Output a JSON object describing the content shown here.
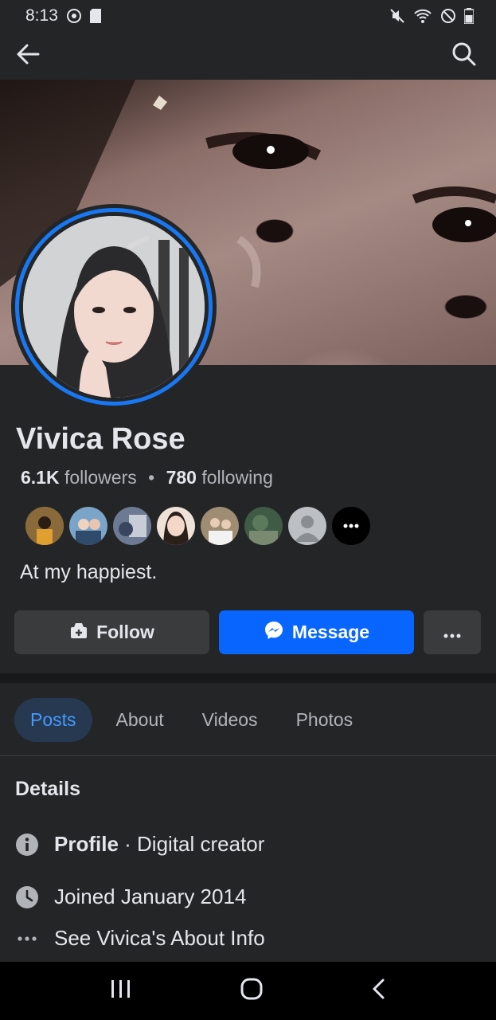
{
  "status_bar": {
    "time": "8:13"
  },
  "profile": {
    "name": "Vivica Rose",
    "followers_count": "6.1K",
    "followers_label": "followers",
    "separator": "•",
    "following_count": "780",
    "following_label": "following",
    "bio": "At my happiest."
  },
  "friends": [
    {
      "name": "friend-1",
      "color": "#c28a3a"
    },
    {
      "name": "friend-2",
      "color": "#3f6f9e"
    },
    {
      "name": "friend-3",
      "color": "#5c6d8a"
    },
    {
      "name": "friend-4",
      "color": "#d9b49c"
    },
    {
      "name": "friend-5",
      "color": "#8a7a66"
    },
    {
      "name": "friend-6",
      "color": "#3f5a45"
    },
    {
      "name": "friend-7",
      "color": "#bcc0c4"
    },
    {
      "name": "friend-more",
      "color": "#000000"
    }
  ],
  "actions": {
    "follow_label": "Follow",
    "message_label": "Message"
  },
  "tabs": [
    {
      "label": "Posts",
      "active": true
    },
    {
      "label": "About",
      "active": false
    },
    {
      "label": "Videos",
      "active": false
    },
    {
      "label": "Photos",
      "active": false
    }
  ],
  "details": {
    "title": "Details",
    "profile_bold": "Profile",
    "profile_rest": " · Digital creator",
    "joined": "Joined January 2014",
    "about_link": "See Vivica's About Info"
  },
  "colors": {
    "background": "#242526",
    "accent": "#0866ff",
    "ring": "#1877f2",
    "active_tab_bg": "#263951",
    "active_tab_text": "#4599ff"
  }
}
